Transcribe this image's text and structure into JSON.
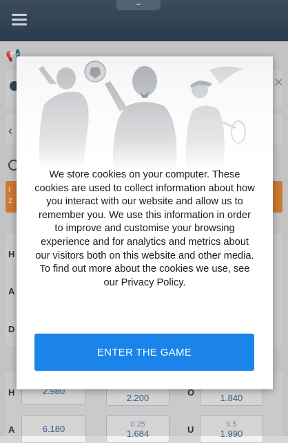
{
  "header": {
    "menu_icon": "hamburger-icon",
    "pull_tab_icon": "chevron-down-icon"
  },
  "background": {
    "orange_strip_left_top": "I",
    "orange_strip_left_bottom": "2",
    "rows": [
      {
        "label": "H"
      },
      {
        "label": "A"
      },
      {
        "label": "D"
      }
    ],
    "odds_rows": [
      {
        "label": "H",
        "odds1": "2.980",
        "mid_line": "",
        "odds2": "2.200",
        "right_label": "O",
        "right_line": "",
        "odds3": "1.840"
      },
      {
        "label": "A",
        "odds1": "6.180",
        "mid_line": "0.25",
        "odds2": "1.684",
        "right_label": "U",
        "right_line": "0.5",
        "odds3": "1.990"
      }
    ]
  },
  "modal": {
    "cookie_text": "We store cookies on your computer. These cookies are used to collect information about how you interact with our website and allow us to remember you. We use this information in order to improve and customise your browsing experience and for analytics and metrics about our visitors both on this website and other media. To find out more about the cookies we use, see our Privacy Policy.",
    "button_label": "ENTER THE GAME",
    "button_color": "#1a84ea"
  }
}
